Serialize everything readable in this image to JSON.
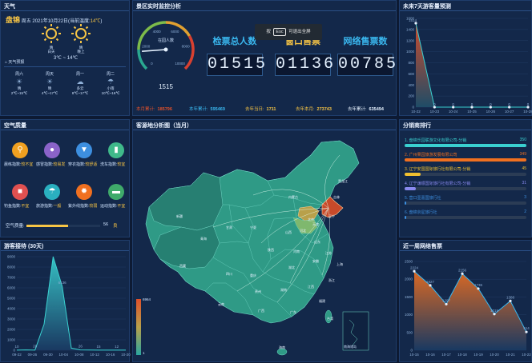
{
  "weather": {
    "title": "天气",
    "city": "盘锦",
    "date_line": "周五 2021年10月22日(当前温度:",
    "current_temp": "14℃",
    "date_close": ")",
    "day_label": "白天",
    "day_cond": "晴",
    "night_label": "晚上",
    "night_cond": "晴",
    "temp_range": "3℃ ~ 14℃",
    "forecast_title": "天气预报",
    "forecast": [
      {
        "day": "周六",
        "cond": "晴",
        "temp": "2℃~15℃"
      },
      {
        "day": "周天",
        "cond": "晴",
        "temp": "4℃~17℃"
      },
      {
        "day": "周一",
        "cond": "多云",
        "temp": "8℃~17℃"
      },
      {
        "day": "周二",
        "cond": "小雨",
        "temp": "10℃~16℃"
      }
    ]
  },
  "monitor": {
    "title": "景区实时监控分析",
    "gauge_label": "在园人数",
    "gauge_value": "1515",
    "gauge_value_num": 1515,
    "gauge_max": 10000,
    "gauge_ticks": [
      "0",
      "2000",
      "4000",
      "6000",
      "8000",
      "10000"
    ],
    "overlay_text_a": "按",
    "overlay_key": "Esc",
    "overlay_text_b": "可退出全屏",
    "counters": [
      {
        "title": "检票总人数",
        "value": "01515"
      },
      {
        "title": "窗口售票",
        "value": "01136"
      },
      {
        "title": "网络售票数",
        "value": "00785"
      }
    ],
    "stats": [
      {
        "label": "本月累计:",
        "value": "185796"
      },
      {
        "label": "本年累计:",
        "value": "595469"
      },
      {
        "label": "去年当日:",
        "value": "1711"
      },
      {
        "label": "去年本月:",
        "value": "273743"
      },
      {
        "label": "去年累计:",
        "value": "635494"
      }
    ]
  },
  "forecast7": {
    "title": "未来7天游客量预测",
    "chart_data": {
      "type": "area",
      "x": [
        "10-22",
        "10-23",
        "10-24",
        "10-25",
        "10-26",
        "10-27",
        "10-28"
      ],
      "values": [
        1514,
        0,
        0,
        0,
        0,
        0,
        0
      ],
      "data_labels": [
        "1514",
        "0",
        "0",
        "0",
        "0",
        "0",
        "0"
      ],
      "ylim": [
        0,
        1600
      ],
      "y_ticks": [
        "0",
        "200",
        "400",
        "600",
        "800",
        "1000",
        "1200",
        "1400",
        "1600"
      ]
    }
  },
  "air": {
    "title": "空气质量",
    "items": [
      {
        "label": "晨练指数:",
        "value": "较不宜",
        "icon": "running-icon",
        "color": "#f0a020"
      },
      {
        "label": "感冒指数:",
        "value": "较易发",
        "icon": "drop-icon",
        "color": "#8a63c9"
      },
      {
        "label": "穿衣指数:",
        "value": "较舒适",
        "icon": "shirt-icon",
        "color": "#3d8fe0"
      },
      {
        "label": "洗车指数:",
        "value": "较宜",
        "icon": "thermometer-icon",
        "color": "#3fb98a"
      },
      {
        "label": "钓鱼指数:",
        "value": "不宜",
        "icon": "luggage-icon",
        "color": "#e05050"
      },
      {
        "label": "旅游指数:",
        "value": "一般",
        "icon": "beach-icon",
        "color": "#2ab0c0"
      },
      {
        "label": "紫外线指数:",
        "value": "较弱",
        "icon": "sun-icon",
        "color": "#f07020"
      },
      {
        "label": "运动指数:",
        "value": "不宜",
        "icon": "car-icon",
        "color": "#3faa6a"
      }
    ],
    "aqi_label": "空气质量:",
    "aqi_value": "56",
    "aqi_grade": "良",
    "aqi_fraction": 0.56
  },
  "history": {
    "title": "游客接待 (30天)",
    "chart_data": {
      "type": "area",
      "x": [
        "09-22",
        "09-26",
        "09-30",
        "10-04",
        "10-08",
        "10-12",
        "10-16",
        "10-20"
      ],
      "series_points": [
        10,
        28,
        14,
        2500,
        9000,
        6136,
        200,
        26,
        15,
        12,
        8,
        12,
        10
      ],
      "data_labels": [
        "10",
        "28",
        "6136",
        "26",
        "15",
        "12"
      ],
      "ylim": [
        0,
        9000
      ],
      "y_ticks": [
        "0",
        "1000",
        "2000",
        "3000",
        "4000",
        "5000",
        "6000",
        "7000",
        "8000",
        "9000"
      ]
    }
  },
  "map": {
    "title": "客源地分析图（当月）",
    "legend_max": "6964",
    "legend_min": "1",
    "places": [
      "黑龙江",
      "吉林",
      "辽宁",
      "内蒙古",
      "北京",
      "天津",
      "河北",
      "山西",
      "山东",
      "河南",
      "陕西",
      "宁夏",
      "甘肃",
      "青海",
      "新疆",
      "西藏",
      "四川",
      "重庆",
      "湖北",
      "安徽",
      "江苏",
      "上海",
      "浙江",
      "江西",
      "湖南",
      "贵州",
      "云南",
      "广西",
      "广东",
      "福建",
      "台湾",
      "海南"
    ],
    "inset_label": "南海诸岛"
  },
  "distributors": {
    "title": "分销商排行",
    "items": [
      {
        "rank": "1.",
        "name": "盘锦乐园联游文化有限公司-分销",
        "value": "350",
        "fraction": 1.0,
        "color": "#3ad0d0"
      },
      {
        "rank": "2.",
        "name": "广州果园旅游发展有限公司",
        "value": "349",
        "fraction": 0.997,
        "color": "#f07020"
      },
      {
        "rank": "3.",
        "name": "辽宁安国国际旅行社有限公司-分销",
        "value": "45",
        "fraction": 0.13,
        "color": "#f0c030"
      },
      {
        "rank": "4.",
        "name": "辽宁谦顺国际旅行社有限公司-分销",
        "value": "31",
        "fraction": 0.09,
        "color": "#8a8af0"
      },
      {
        "rank": "5.",
        "name": "营口壹嘉国旅行社",
        "value": "3",
        "fraction": 0.01,
        "color": "#3d8fe0"
      },
      {
        "rank": "6.",
        "name": "盘锦京星旅行社",
        "value": "2",
        "fraction": 0.006,
        "color": "#3d8fe0"
      }
    ]
  },
  "weekly": {
    "title": "近一周网络售票",
    "chart_data": {
      "type": "area",
      "x": [
        "10-15",
        "10-16",
        "10-17",
        "10-18",
        "10-19",
        "10-20",
        "10-21",
        "10-22"
      ],
      "values": [
        2224,
        1827,
        1297,
        2156,
        1736,
        1019,
        1388,
        514
      ],
      "data_labels": [
        "2224",
        "1827",
        "1297",
        "2156",
        "1736",
        "1019",
        "1388",
        "514"
      ],
      "ylim": [
        0,
        2500
      ],
      "y_ticks": [
        "0",
        "500",
        "1000",
        "1500",
        "2000",
        "2500"
      ]
    }
  }
}
